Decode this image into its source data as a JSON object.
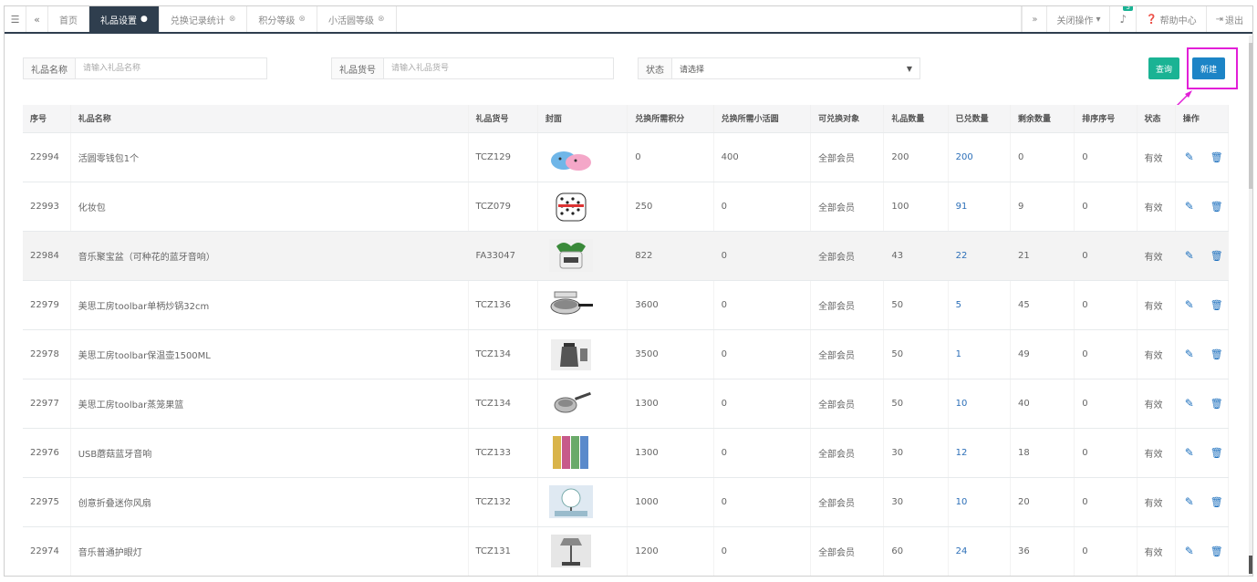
{
  "topbar": {
    "tabs": [
      {
        "label": "首页",
        "closable": false,
        "active": false
      },
      {
        "label": "礼品设置",
        "closable": true,
        "active": true
      },
      {
        "label": "兑换记录统计",
        "closable": true,
        "active": false
      },
      {
        "label": "积分等级",
        "closable": true,
        "active": false
      },
      {
        "label": "小活圆等级",
        "closable": true,
        "active": false
      }
    ],
    "close_ops_label": "关闭操作",
    "bell_badge": "5",
    "help_label": "帮助中心",
    "logout_label": "退出"
  },
  "filters": {
    "name_label": "礼品名称",
    "name_placeholder": "请输入礼品名称",
    "code_label": "礼品货号",
    "code_placeholder": "请输入礼品货号",
    "status_label": "状态",
    "status_value": "请选择",
    "query_label": "查询",
    "new_label": "新建"
  },
  "table": {
    "headers": [
      "序号",
      "礼品名称",
      "礼品货号",
      "封面",
      "兑换所需积分",
      "兑换所需小活圆",
      "可兑换对象",
      "礼品数量",
      "已兑数量",
      "剩余数量",
      "排序序号",
      "状态",
      "操作"
    ],
    "rows": [
      {
        "id": "22994",
        "name": "活圆零钱包1个",
        "code": "TCZ129",
        "cover": "pouch",
        "points": "0",
        "coins": "400",
        "target": "全部会员",
        "qty": "200",
        "used": "200",
        "left": "0",
        "sort": "0",
        "status": "有效"
      },
      {
        "id": "22993",
        "name": "化妆包",
        "code": "TCZ079",
        "cover": "dotbag",
        "points": "250",
        "coins": "0",
        "target": "全部会员",
        "qty": "100",
        "used": "91",
        "left": "9",
        "sort": "0",
        "status": "有效"
      },
      {
        "id": "22984",
        "name": "音乐聚宝盆（可种花的蓝牙音响）",
        "code": "FA33047",
        "cover": "planter",
        "points": "822",
        "coins": "0",
        "target": "全部会员",
        "qty": "43",
        "used": "22",
        "left": "21",
        "sort": "0",
        "status": "有效"
      },
      {
        "id": "22979",
        "name": "美思工房toolbar单柄炒锅32cm",
        "code": "TCZ136",
        "cover": "pan",
        "points": "3600",
        "coins": "0",
        "target": "全部会员",
        "qty": "50",
        "used": "5",
        "left": "45",
        "sort": "0",
        "status": "有效"
      },
      {
        "id": "22978",
        "name": "美思工房toolbar保温壶1500ML",
        "code": "TCZ134",
        "cover": "kettle",
        "points": "3500",
        "coins": "0",
        "target": "全部会员",
        "qty": "50",
        "used": "1",
        "left": "49",
        "sort": "0",
        "status": "有效"
      },
      {
        "id": "22977",
        "name": "美思工房toolbar蒸笼果篮",
        "code": "TCZ134",
        "cover": "strainer",
        "points": "1300",
        "coins": "0",
        "target": "全部会员",
        "qty": "50",
        "used": "10",
        "left": "40",
        "sort": "0",
        "status": "有效"
      },
      {
        "id": "22976",
        "name": "USB蘑菇蓝牙音响",
        "code": "TCZ133",
        "cover": "speakers",
        "points": "1300",
        "coins": "0",
        "target": "全部会员",
        "qty": "30",
        "used": "12",
        "left": "18",
        "sort": "0",
        "status": "有效"
      },
      {
        "id": "22975",
        "name": "创意折叠迷你风扇",
        "code": "TCZ132",
        "cover": "fan",
        "points": "1000",
        "coins": "0",
        "target": "全部会员",
        "qty": "30",
        "used": "10",
        "left": "20",
        "sort": "0",
        "status": "有效"
      },
      {
        "id": "22974",
        "name": "音乐普通护眼灯",
        "code": "TCZ131",
        "cover": "lamp",
        "points": "1200",
        "coins": "0",
        "target": "全部会员",
        "qty": "60",
        "used": "24",
        "left": "36",
        "sort": "0",
        "status": "有效"
      }
    ],
    "highlight_row": 2
  },
  "icons": {
    "edit": "pencil-icon",
    "delete": "trash-icon"
  },
  "colors": {
    "topbar_active": "#2f3e4e",
    "query_button": "#1ab394",
    "new_button": "#1c84c6",
    "highlight_box": "#e21fd7",
    "link": "#2c6fb8"
  }
}
